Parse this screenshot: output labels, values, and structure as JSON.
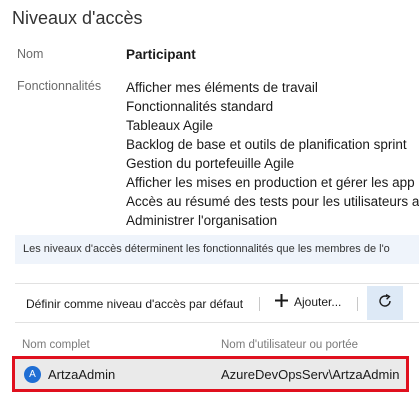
{
  "page": {
    "title": "Niveaux d'accès"
  },
  "details": {
    "name_label": "Nom",
    "name_value": "Participant",
    "features_label": "Fonctionnalités",
    "features": [
      "Afficher mes éléments de travail",
      "Fonctionnalités standard",
      "Tableaux Agile",
      "Backlog de base et outils de planification sprint",
      "Gestion du portefeuille Agile",
      "Afficher les mises en production et gérer les app",
      "Accès au résumé des tests pour les utilisateurs a",
      "Administrer l'organisation"
    ]
  },
  "info_bar": {
    "text": "Les niveaux d'accès déterminent les fonctionnalités que les membres de l'o"
  },
  "toolbar": {
    "set_default_label": "Définir comme niveau d'accès par défaut",
    "add_label": "Ajouter...",
    "add_icon": "plus-icon",
    "refresh_icon": "refresh-icon"
  },
  "table": {
    "columns": [
      "Nom complet",
      "Nom d'utilisateur ou portée"
    ],
    "rows": [
      {
        "initial": "A",
        "full_name": "ArtzaAdmin",
        "username": "AzureDevOpsServ\\ArtzaAdmin"
      }
    ]
  },
  "colors": {
    "accent": "#1f6ed4",
    "highlight_border": "#e0101e",
    "info_bg": "#eff4fb"
  }
}
